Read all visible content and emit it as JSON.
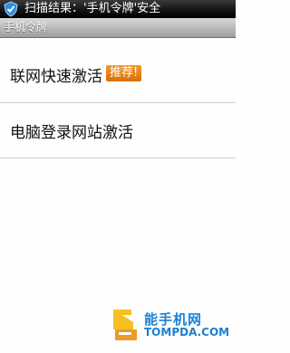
{
  "status_bar": {
    "icon": "shield-check-icon",
    "text": "扫描结果：'手机令牌'安全"
  },
  "title_bar": {
    "title": "手机令牌"
  },
  "menu": {
    "items": [
      {
        "label": "联网快速激活",
        "badge": "推荐!"
      },
      {
        "label": "电脑登录网站激活"
      }
    ]
  },
  "watermark": {
    "logo_icon": "zhi-logo-icon",
    "cn": "能手机网",
    "en": "TOMPDA.COM"
  }
}
